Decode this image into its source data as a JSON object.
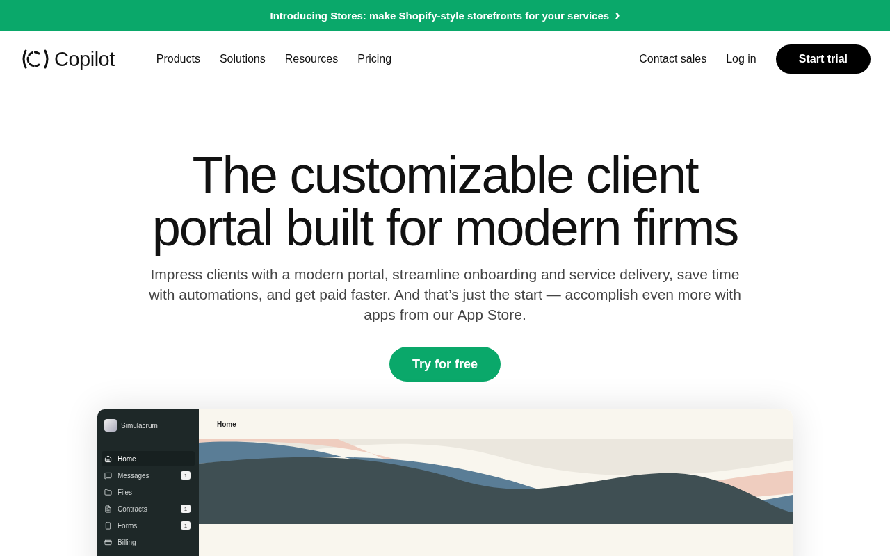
{
  "announcement": {
    "text": "Introducing Stores: make Shopify-style storefronts for your services",
    "arrow": "›"
  },
  "nav": {
    "logo": "Copilot",
    "links": [
      "Products",
      "Solutions",
      "Resources",
      "Pricing"
    ],
    "contact": "Contact sales",
    "login": "Log in",
    "cta": "Start trial"
  },
  "hero": {
    "title_lines": [
      "The customizable client",
      "portal built for modern firms"
    ],
    "subtitle": "Impress clients with a modern portal, streamline onboarding and service delivery, save time with automations, and get paid faster. And that’s just the start — accomplish even more with apps from our App Store.",
    "cta": "Try for free"
  },
  "preview": {
    "workspace": "Simulacrum",
    "page_title": "Home",
    "sidebar": [
      {
        "kind": "home",
        "label": "Home",
        "selected": true
      },
      {
        "kind": "messages",
        "label": "Messages",
        "selected": false,
        "badge": "1"
      },
      {
        "kind": "files",
        "label": "Files",
        "selected": false
      },
      {
        "kind": "contracts",
        "label": "Contracts",
        "selected": false,
        "badge": "1"
      },
      {
        "kind": "forms",
        "label": "Forms",
        "selected": false,
        "badge": "1"
      },
      {
        "kind": "billing",
        "label": "Billing",
        "selected": false
      }
    ]
  }
}
